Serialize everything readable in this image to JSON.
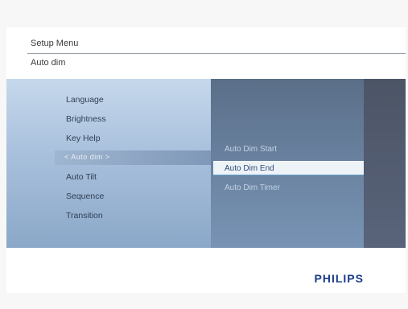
{
  "header": {
    "title": "Setup Menu",
    "subtitle": "Auto dim"
  },
  "left_menu": {
    "items": [
      {
        "label": "Language"
      },
      {
        "label": "Brightness"
      },
      {
        "label": "Key Help"
      },
      {
        "label": "Auto Tilt"
      },
      {
        "label": "Sequence"
      },
      {
        "label": "Transition"
      }
    ],
    "selected_label": "< Auto dim >"
  },
  "right_menu": {
    "items": [
      {
        "label": "Auto Dim Start"
      },
      {
        "label": "Auto Dim End"
      },
      {
        "label": "Auto Dim Timer"
      }
    ]
  },
  "footer": {
    "brand": "PHILIPS"
  },
  "colors": {
    "brand": "#1a3c8c",
    "left_panel": "#a8c0dc",
    "right_panel": "#6b84a2",
    "highlight": "#eef3f8"
  }
}
